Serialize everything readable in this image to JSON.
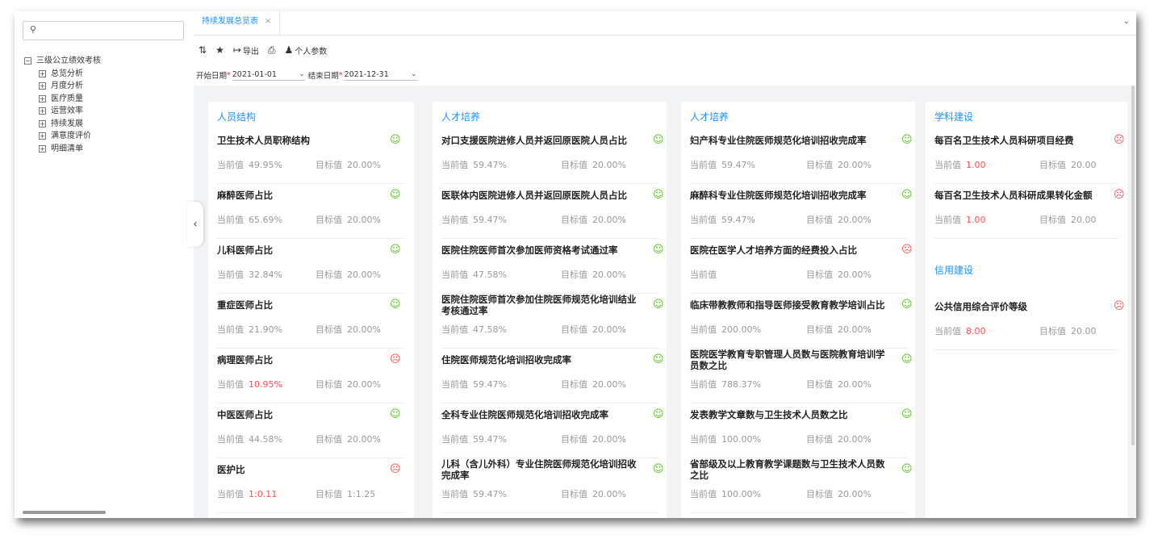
{
  "search": {
    "icon": "search-icon"
  },
  "tree": {
    "root": "三级公立绩效考核",
    "children": [
      "总览分析",
      "月度分析",
      "医疗质量",
      "运营效率",
      "持续发展",
      "满意度评价",
      "明细清单"
    ]
  },
  "tab": {
    "label": "持续发展总览表",
    "close": "×"
  },
  "toolbar": {
    "export": "导出",
    "params": "个人参数"
  },
  "filter": {
    "start_label": "开始日期",
    "start_value": "2021-01-01",
    "end_label": "结束日期",
    "end_value": "2021-12-31",
    "required_mark": "*"
  },
  "labels": {
    "current": "当前值",
    "target": "目标值"
  },
  "cards": [
    {
      "title": "人员结构",
      "items": [
        {
          "name": "卫生技术人员职称结构",
          "current": "49.95%",
          "target": "20.00%",
          "status": "good"
        },
        {
          "name": "麻醉医师占比",
          "current": "65.69%",
          "target": "20.00%",
          "status": "good"
        },
        {
          "name": "儿科医师占比",
          "current": "32.84%",
          "target": "20.00%",
          "status": "good"
        },
        {
          "name": "重症医师占比",
          "current": "21.90%",
          "target": "20.00%",
          "status": "good"
        },
        {
          "name": "病理医师占比",
          "current": "10.95%",
          "target": "20.00%",
          "status": "bad"
        },
        {
          "name": "中医医师占比",
          "current": "44.58%",
          "target": "20.00%",
          "status": "good"
        },
        {
          "name": "医护比",
          "current": "1:0.11",
          "target": "1:1.25",
          "status": "bad"
        }
      ]
    },
    {
      "title": "人才培养",
      "items": [
        {
          "name": "对口支援医院进修人员并返回原医院人员占比",
          "current": "59.47%",
          "target": "20.00%",
          "status": "good"
        },
        {
          "name": "医联体内医院进修人员并返回原医院人员占比",
          "current": "59.47%",
          "target": "20.00%",
          "status": "good"
        },
        {
          "name": "医院住院医师首次参加医师资格考试通过率",
          "current": "47.58%",
          "target": "20.00%",
          "status": "good"
        },
        {
          "name": "医院住院医师首次参加住院医师规范化培训结业考核通过率",
          "current": "47.58%",
          "target": "20.00%",
          "status": "good"
        },
        {
          "name": "住院医师规范化培训招收完成率",
          "current": "59.47%",
          "target": "20.00%",
          "status": "good"
        },
        {
          "name": "全科专业住院医师规范化培训招收完成率",
          "current": "59.47%",
          "target": "20.00%",
          "status": "good"
        },
        {
          "name": "儿科（含儿外科）专业住院医师规范化培训招收完成率",
          "current": "59.47%",
          "target": "20.00%",
          "status": "good"
        }
      ]
    },
    {
      "title": "人才培养",
      "items": [
        {
          "name": "妇产科专业住院医师规范化培训招收完成率",
          "current": "59.47%",
          "target": "20.00%",
          "status": "good"
        },
        {
          "name": "麻醉科专业住院医师规范化培训招收完成率",
          "current": "59.47%",
          "target": "20.00%",
          "status": "good"
        },
        {
          "name": "医院在医学人才培养方面的经费投入占比",
          "current": "",
          "target": "20.00%",
          "status": "bad"
        },
        {
          "name": "临床带教教师和指导医师接受教育教学培训占比",
          "current": "200.00%",
          "target": "20.00%",
          "status": "good"
        },
        {
          "name": "医院医学教育专职管理人员数与医院教育培训学员数之比",
          "current": "788.37%",
          "target": "20.00%",
          "status": "good"
        },
        {
          "name": "发表教学文章数与卫生技术人员数之比",
          "current": "100.00%",
          "target": "20.00%",
          "status": "good"
        },
        {
          "name": "省部级及以上教育教学课题数与卫生技术人员数之比",
          "current": "100.00%",
          "target": "20.00%",
          "status": "good"
        }
      ]
    },
    {
      "title": "学科建设",
      "items": [
        {
          "name": "每百名卫生技术人员科研项目经费",
          "current": "1.00",
          "target": "20.00",
          "status": "bad"
        },
        {
          "name": "每百名卫生技术人员科研成果转化金额",
          "current": "1.00",
          "target": "20.00",
          "status": "bad"
        }
      ],
      "title2": "信用建设",
      "items2": [
        {
          "name": "公共信用综合评价等级",
          "current": "8.00",
          "target": "20.00",
          "status": "bad"
        }
      ]
    }
  ],
  "colors": {
    "accent": "#1890ff",
    "good": "#52c41a",
    "bad": "#ff4d4f"
  }
}
